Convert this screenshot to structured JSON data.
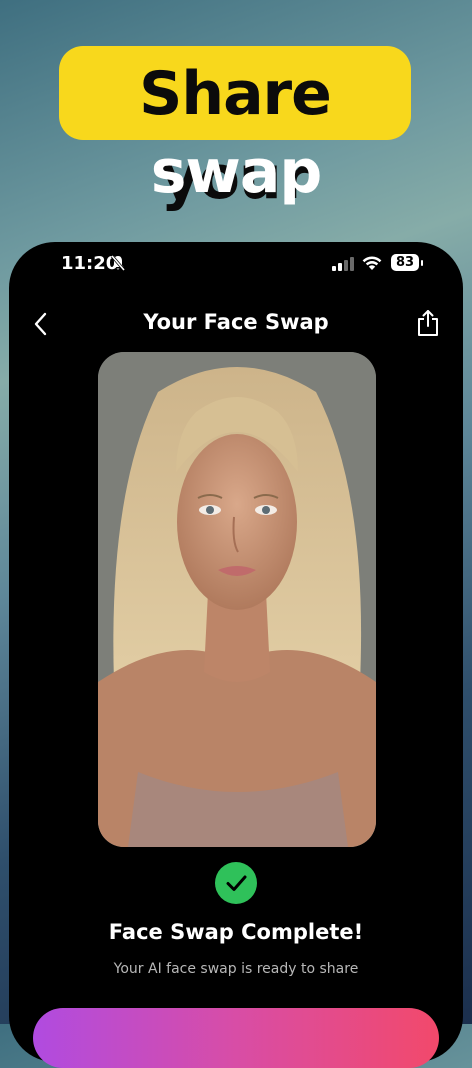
{
  "headline": {
    "line1": "Share your",
    "line2": "swap"
  },
  "status_bar": {
    "time": "11:20",
    "battery": "83",
    "icons": [
      "bell-slash-icon",
      "cellular-signal-icon",
      "wifi-icon",
      "battery-icon"
    ]
  },
  "nav": {
    "title": "Your Face Swap",
    "back_icon": "chevron-left-icon",
    "share_icon": "share-icon"
  },
  "result": {
    "status_icon": "checkmark-icon",
    "title": "Face Swap Complete!",
    "subtitle": "Your AI face swap is ready to share"
  },
  "colors": {
    "headline_pill": "#f8d81c",
    "success": "#2fc15a",
    "cta_start": "#b04be0",
    "cta_end": "#f2496b"
  }
}
